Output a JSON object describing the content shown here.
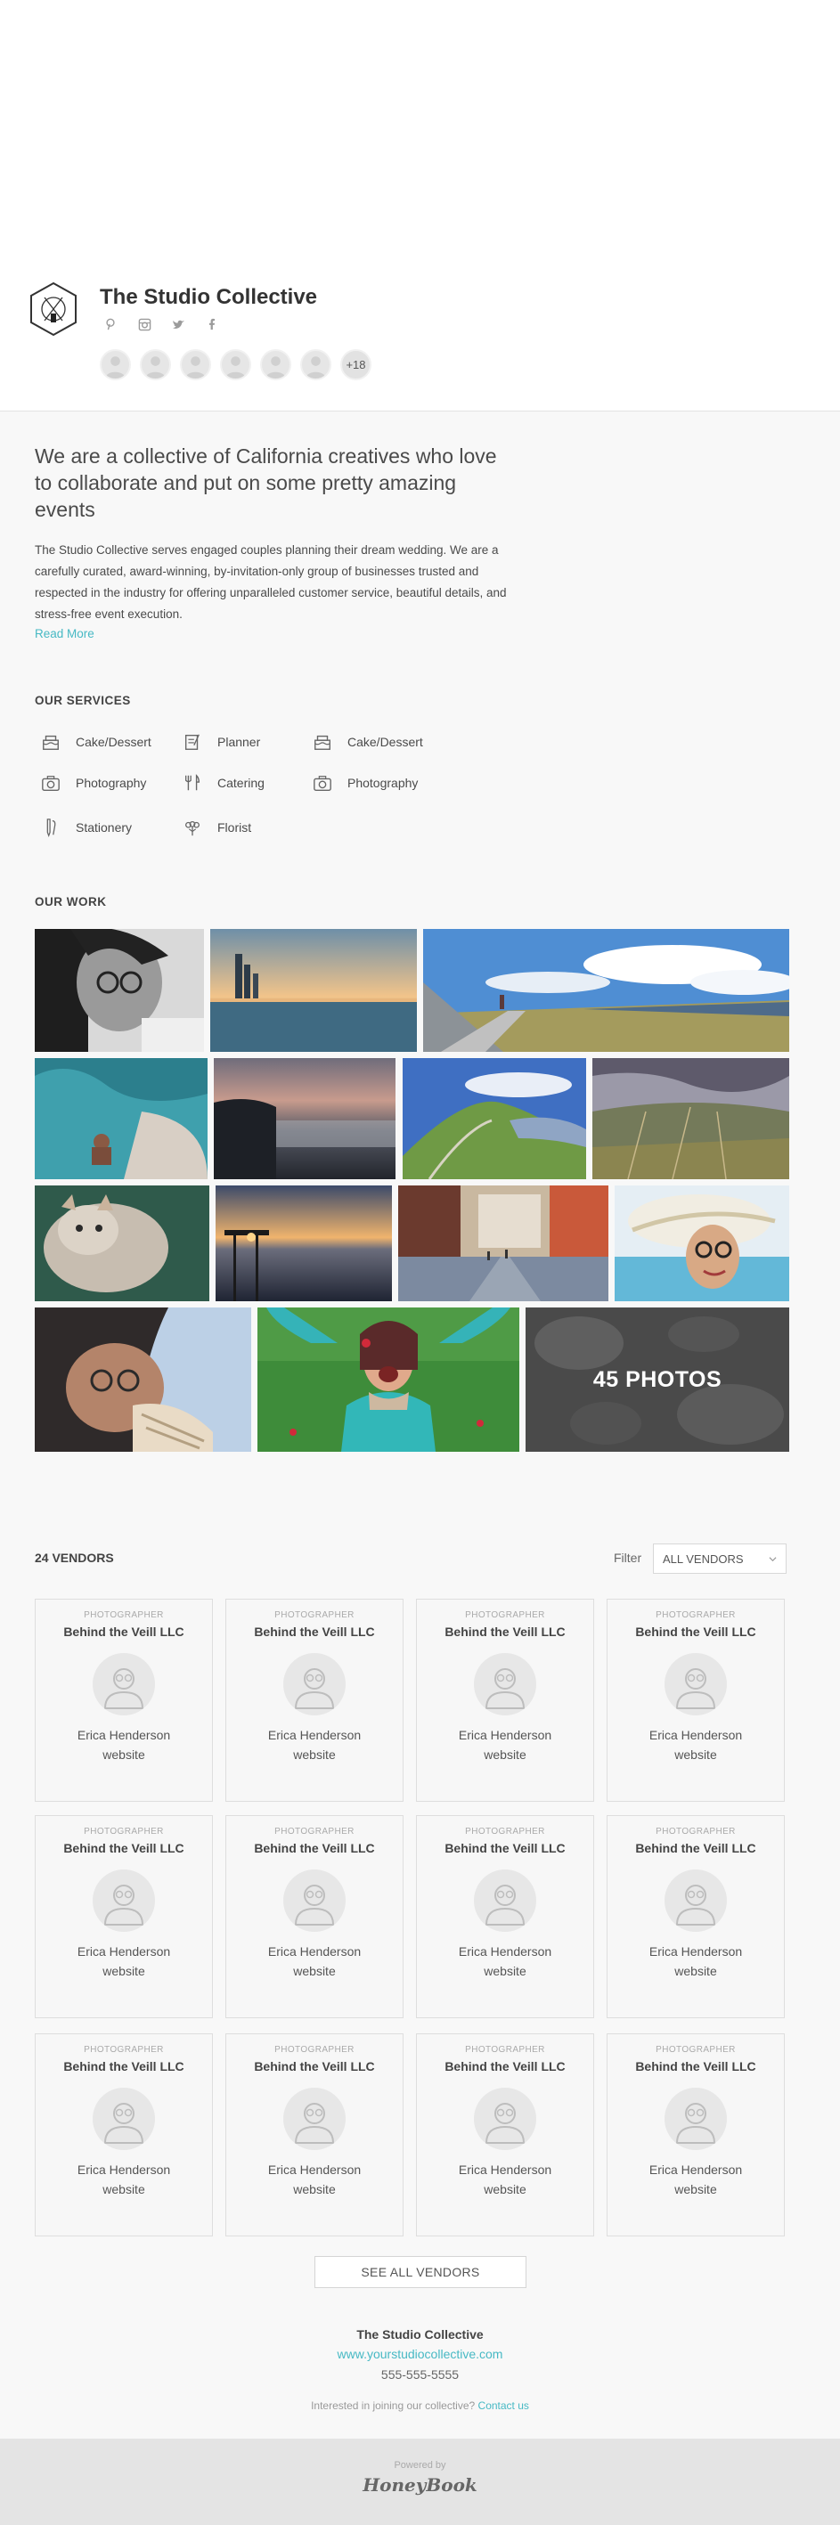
{
  "brand": {
    "name": "The Studio Collective",
    "member_more": "+18"
  },
  "socials": [
    "pinterest-icon",
    "instagram-icon",
    "twitter-icon",
    "facebook-icon"
  ],
  "about": {
    "headline": "We are a collective of California creatives who love to collaborate and put on some pretty amazing events",
    "body": "The Studio Collective serves engaged couples planning their dream wedding. We are a carefully curated, award-winning, by-invitation-only group of businesses trusted and respected in the industry for offering unparalleled customer service, beautiful details, and stress-free event execution.",
    "read_more": "Read More"
  },
  "services": {
    "title": "OUR SERVICES",
    "items": [
      {
        "label": "Cake/Dessert",
        "icon": "cake-icon"
      },
      {
        "label": "Planner",
        "icon": "clipboard-icon"
      },
      {
        "label": "Cake/Dessert",
        "icon": "cake-icon"
      },
      {
        "label": "Photography",
        "icon": "camera-icon"
      },
      {
        "label": "Catering",
        "icon": "fork-knife-icon"
      },
      {
        "label": "Photography",
        "icon": "camera-icon"
      },
      {
        "label": "Stationery",
        "icon": "pen-icon"
      },
      {
        "label": "Florist",
        "icon": "flower-icon"
      }
    ]
  },
  "work": {
    "title": "OUR WORK",
    "more_label": "45 PHOTOS"
  },
  "vendors": {
    "title": "24 VENDORS",
    "filter_label": "Filter",
    "filter_value": "ALL VENDORS",
    "role": "PHOTOGRAPHER",
    "company": "Behind the Veill LLC",
    "person": "Erica Henderson",
    "link": "website",
    "see_all": "SEE ALL VENDORS"
  },
  "footer": {
    "name": "The Studio Collective",
    "website": "www.yourstudiocollective.com",
    "phone": "555-555-5555",
    "join_text": "Interested in joining our collective?",
    "join_link": "Contact us",
    "powered_by": "Powered by",
    "powered_brand": "HoneyBook"
  }
}
